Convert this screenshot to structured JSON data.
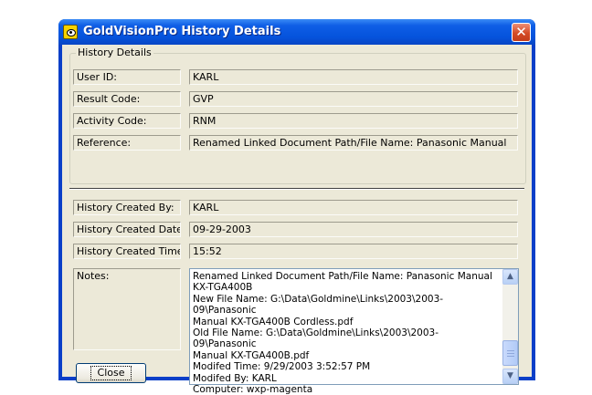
{
  "window": {
    "title": "GoldVisionPro History Details",
    "close_glyph": "✕",
    "icon": "goldvisionpro-eye-icon"
  },
  "history_group": {
    "legend": "History Details",
    "fields": [
      {
        "label": "User ID:",
        "value": "KARL"
      },
      {
        "label": "Result Code:",
        "value": "GVP"
      },
      {
        "label": "Activity Code:",
        "value": "RNM"
      },
      {
        "label": "Reference:",
        "value": "Renamed Linked Document Path/File Name: Panasonic Manual"
      }
    ]
  },
  "created_fields": [
    {
      "label": "History Created By:",
      "value": "KARL"
    },
    {
      "label": "History Created Date:",
      "value": "09-29-2003"
    },
    {
      "label": "History Created Time:",
      "value": "15:52"
    }
  ],
  "notes": {
    "label": "Notes:",
    "text": "Renamed Linked Document Path/File Name: Panasonic Manual\nKX-TGA400B\nNew File Name: G:\\Data\\Goldmine\\Links\\2003\\2003-09\\Panasonic\nManual KX-TGA400B Cordless.pdf\nOld File Name: G:\\Data\\Goldmine\\Links\\2003\\2003-09\\Panasonic\nManual KX-TGA400B.pdf\nModifed Time: 9/29/2003 3:52:57 PM\nModifed By: KARL\nComputer: wxp-magenta"
  },
  "buttons": {
    "close_label": "Close"
  },
  "colors": {
    "titlebar": "#0553dc",
    "dialog_face": "#ece9d8",
    "close_button": "#d44b26"
  }
}
